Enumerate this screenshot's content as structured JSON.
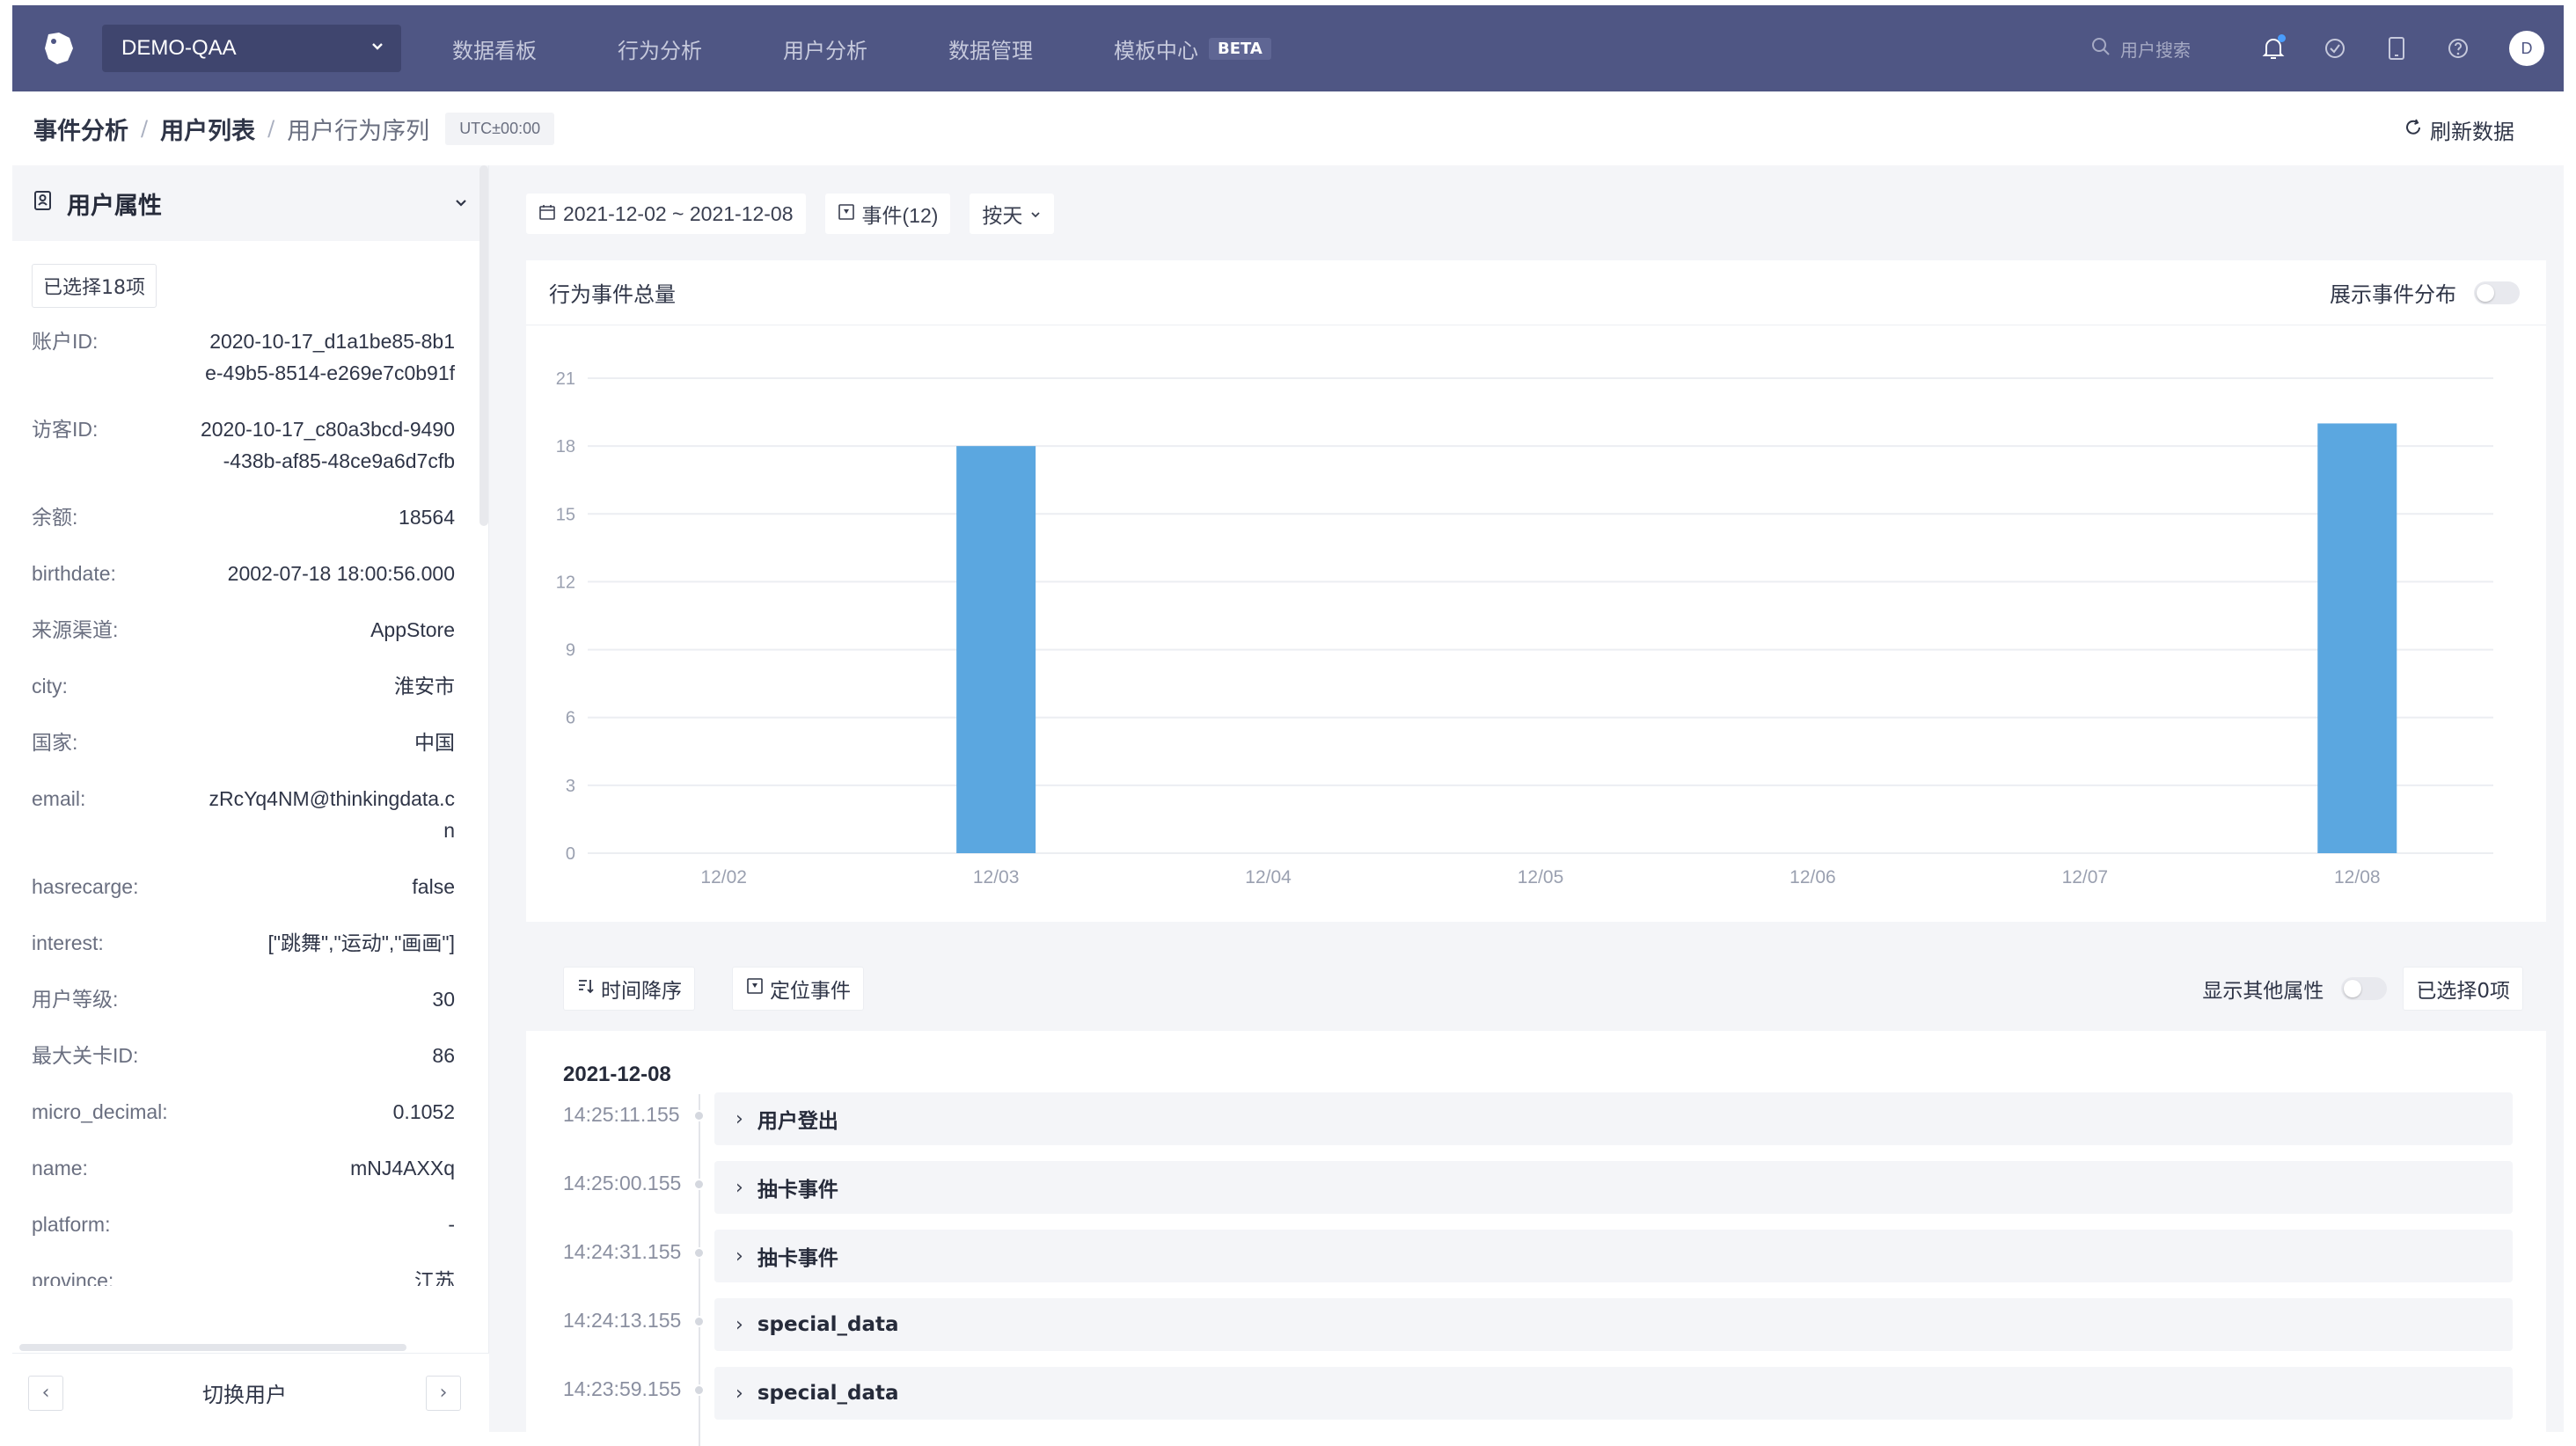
{
  "topnav": {
    "project": "DEMO-QAA",
    "items": [
      "数据看板",
      "行为分析",
      "用户分析",
      "数据管理",
      "模板中心"
    ],
    "beta": "BETA",
    "search_placeholder": "用户搜索",
    "avatar": "D",
    "icons": [
      "bell-icon",
      "check-circle-icon",
      "tablet-icon",
      "help-icon"
    ]
  },
  "breadcrumb": {
    "items": [
      "事件分析",
      "用户列表",
      "用户行为序列"
    ],
    "timezone": "UTC±00:00",
    "refresh": "刷新数据"
  },
  "user_panel": {
    "title": "用户属性",
    "selected": "已选择18项",
    "properties": [
      {
        "key": "账户ID:",
        "value": "2020-10-17_d1a1be85-8b1e-49b5-8514-e269e7c0b91f"
      },
      {
        "key": "访客ID:",
        "value": "2020-10-17_c80a3bcd-9490-438b-af85-48ce9a6d7cfb"
      },
      {
        "key": "余额:",
        "value": "18564"
      },
      {
        "key": "birthdate:",
        "value": "2002-07-18 18:00:56.000"
      },
      {
        "key": "来源渠道:",
        "value": "AppStore"
      },
      {
        "key": "city:",
        "value": "淮安市"
      },
      {
        "key": "国家:",
        "value": "中国"
      },
      {
        "key": "email:",
        "value": "zRcYq4NM@thinkingdata.cn"
      },
      {
        "key": "hasrecarge:",
        "value": "false"
      },
      {
        "key": "interest:",
        "value": "[\"跳舞\",\"运动\",\"画画\"]"
      },
      {
        "key": "用户等级:",
        "value": "30"
      },
      {
        "key": "最大关卡ID:",
        "value": "86"
      },
      {
        "key": "micro_decimal:",
        "value": "0.1052"
      },
      {
        "key": "name:",
        "value": "mNJ4AXXq"
      },
      {
        "key": "platform:",
        "value": "-"
      },
      {
        "key": "province:",
        "value": "江苏"
      }
    ],
    "switch_user": "切换用户"
  },
  "filters": {
    "date_range": "2021-12-02 ~ 2021-12-08",
    "events": "事件(12)",
    "granularity": "按天"
  },
  "chart_card": {
    "title": "行为事件总量",
    "toggle_label": "展示事件分布"
  },
  "chart_data": {
    "type": "bar",
    "categories": [
      "12/02",
      "12/03",
      "12/04",
      "12/05",
      "12/06",
      "12/07",
      "12/08"
    ],
    "values": [
      0,
      18,
      0,
      0,
      0,
      0,
      19
    ],
    "ylim": [
      0,
      21
    ],
    "yticks": [
      0,
      3,
      6,
      9,
      12,
      15,
      18,
      21
    ],
    "color": "#5ba7e0",
    "grid": true
  },
  "events_panel": {
    "sort_label": "时间降序",
    "locate_label": "定位事件",
    "other_props_label": "显示其他属性",
    "selected": "已选择0项",
    "date": "2021-12-08",
    "rows": [
      {
        "time": "14:25:11.155",
        "name": "用户登出"
      },
      {
        "time": "14:25:00.155",
        "name": "抽卡事件"
      },
      {
        "time": "14:24:31.155",
        "name": "抽卡事件"
      },
      {
        "time": "14:24:13.155",
        "name": "special_data"
      },
      {
        "time": "14:23:59.155",
        "name": "special_data"
      }
    ]
  }
}
